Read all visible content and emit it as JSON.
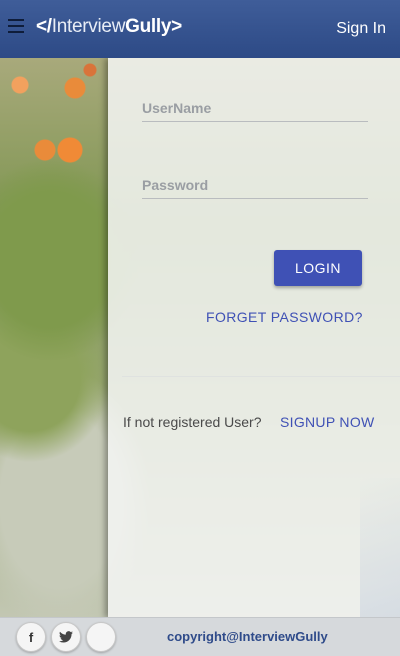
{
  "header": {
    "menu_icon": "hamburger-icon",
    "logo": {
      "prefix": "</",
      "part1": "Interview",
      "part2": "Gully",
      "suffix": ">"
    },
    "signin_label": "Sign In"
  },
  "form": {
    "username_placeholder": "UserName",
    "password_placeholder": "Password",
    "login_label": "LOGIN",
    "forget_label": "FORGET PASSWORD?",
    "not_registered_text": "If not registered User?",
    "signup_label": "SIGNUP NOW"
  },
  "footer": {
    "social": [
      {
        "icon": "facebook-icon",
        "glyph": "f"
      },
      {
        "icon": "twitter-icon",
        "glyph": "🐦"
      },
      {
        "icon": "googleplus-icon",
        "glyph": ""
      }
    ],
    "copyright": "copyright@InterviewGully"
  },
  "colors": {
    "header": "#2d4a86",
    "accent": "#3f51b5",
    "footer": "#d6d9dc"
  }
}
